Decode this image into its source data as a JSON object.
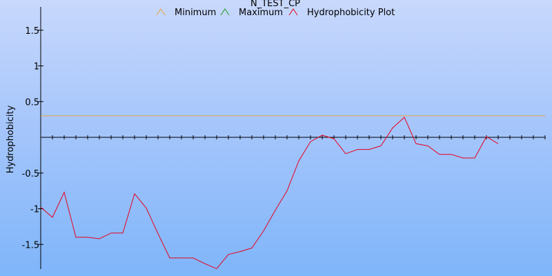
{
  "chart_data": {
    "type": "line",
    "title": "N_TEST_CP",
    "xlabel": "",
    "ylabel": "Hydrophobicity",
    "ylim": [
      -1.85,
      1.85
    ],
    "xlim": [
      1,
      44
    ],
    "yticks": [
      1.5,
      1,
      0.5,
      -0.5,
      -1,
      -1.5
    ],
    "ytick_labels": [
      "1.5",
      "1",
      "0.5",
      "-0.5",
      "-1",
      "-1.5"
    ],
    "x": [
      1,
      2,
      3,
      4,
      5,
      6,
      7,
      8,
      9,
      10,
      11,
      12,
      13,
      14,
      15,
      16,
      17,
      18,
      19,
      20,
      21,
      22,
      23,
      24,
      25,
      26,
      27,
      28,
      29,
      30,
      31,
      32,
      33,
      34,
      35,
      36,
      37,
      38,
      39,
      40,
      41,
      42,
      43,
      44
    ],
    "series": [
      {
        "name": "Minimum",
        "color": "#e8a33c",
        "values": [
          0.3,
          0.3,
          0.3,
          0.3,
          0.3,
          0.3,
          0.3,
          0.3,
          0.3,
          0.3,
          0.3,
          0.3,
          0.3,
          0.3,
          0.3,
          0.3,
          0.3,
          0.3,
          0.3,
          0.3,
          0.3,
          0.3,
          0.3,
          0.3,
          0.3,
          0.3,
          0.3,
          0.3,
          0.3,
          0.3,
          0.3,
          0.3,
          0.3,
          0.3,
          0.3,
          0.3,
          0.3,
          0.3,
          0.3,
          0.3,
          0.3,
          0.3,
          0.3,
          0.3
        ]
      },
      {
        "name": "Maximum",
        "color": "#1a9a1a",
        "values": []
      },
      {
        "name": "Hydrophobicity Plot",
        "color": "#e8001c",
        "values": [
          -0.98,
          -1.12,
          -0.77,
          -1.4,
          -1.4,
          -1.42,
          -1.34,
          -1.34,
          -0.79,
          -0.99,
          -1.35,
          -1.69,
          -1.69,
          -1.69,
          -1.77,
          -1.84,
          -1.64,
          -1.6,
          -1.55,
          -1.31,
          -1.02,
          -0.75,
          -0.33,
          -0.06,
          0.03,
          -0.02,
          -0.23,
          -0.17,
          -0.17,
          -0.12,
          0.13,
          0.28,
          -0.09,
          -0.12,
          -0.24,
          -0.24,
          -0.29,
          -0.29,
          0.01,
          -0.09
        ]
      }
    ],
    "grid": false,
    "legend_position": "top-center"
  }
}
